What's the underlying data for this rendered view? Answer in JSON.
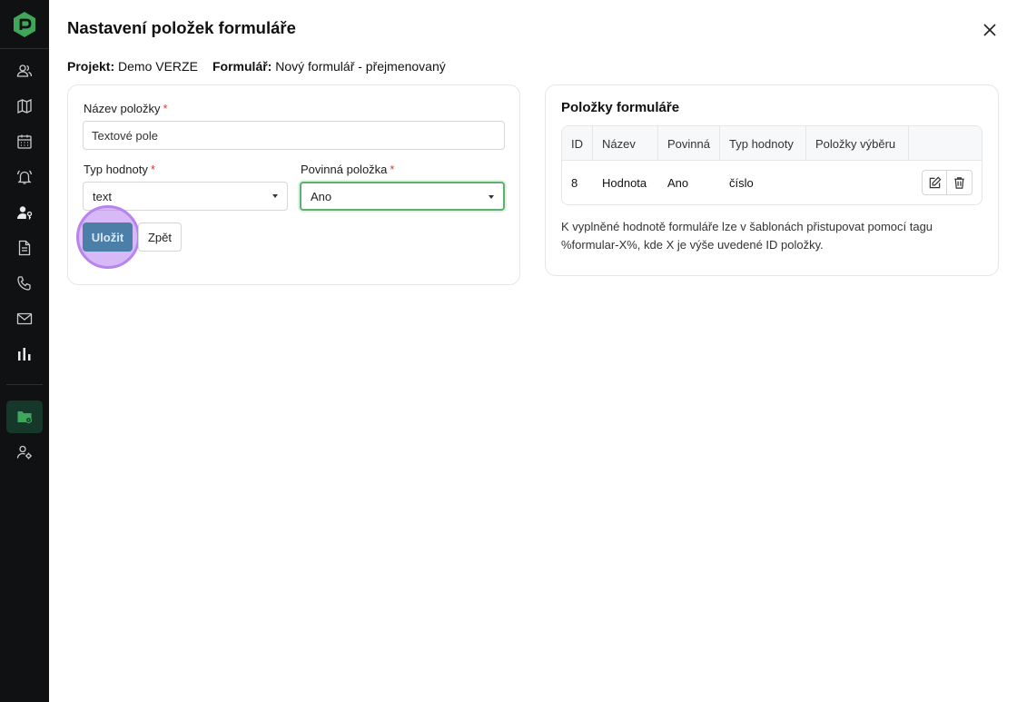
{
  "sidebar": {
    "logo": "app-logo",
    "items": [
      {
        "name": "contacts",
        "icon": "users-icon"
      },
      {
        "name": "map",
        "icon": "map-icon"
      },
      {
        "name": "calendar",
        "icon": "calendar-icon"
      },
      {
        "name": "notifications",
        "icon": "bell-icon"
      },
      {
        "name": "user-settings",
        "icon": "user-key-icon"
      },
      {
        "name": "documents",
        "icon": "document-icon"
      },
      {
        "name": "calls",
        "icon": "phone-icon"
      },
      {
        "name": "email",
        "icon": "mail-icon"
      },
      {
        "name": "reports",
        "icon": "bar-chart-icon"
      },
      {
        "name": "projects",
        "icon": "folder-settings-icon",
        "active": true
      },
      {
        "name": "admin",
        "icon": "user-cog-icon"
      }
    ],
    "active_color": "#16382a",
    "accent_color": "#3ea75a"
  },
  "header": {
    "title": "Nastavení položek formuláře",
    "project_label": "Projekt:",
    "project_value": "Demo VERZE",
    "form_label": "Formulář:",
    "form_value": "Nový formulář - přejmenovaný",
    "close_icon": "close-icon"
  },
  "form": {
    "name_label": "Název položky",
    "name_value": "Textové pole",
    "required_mark": "*",
    "type_label": "Typ hodnoty",
    "type_value": "text",
    "mandatory_label": "Povinná položka",
    "mandatory_value": "Ano",
    "save_label": "Uložit",
    "back_label": "Zpět"
  },
  "items_panel": {
    "title": "Položky formuláře",
    "columns": [
      "ID",
      "Název",
      "Povinná",
      "Typ hodnoty",
      "Položky výběru"
    ],
    "rows": [
      {
        "id": "8",
        "name": "Hodnota",
        "required": "Ano",
        "type": "číslo",
        "choices": ""
      }
    ],
    "note": "K vyplněné hodnotě formuláře lze v šablonách přistupovat pomocí tagu %formular-X%, kde X je výše uvedené ID položky."
  }
}
